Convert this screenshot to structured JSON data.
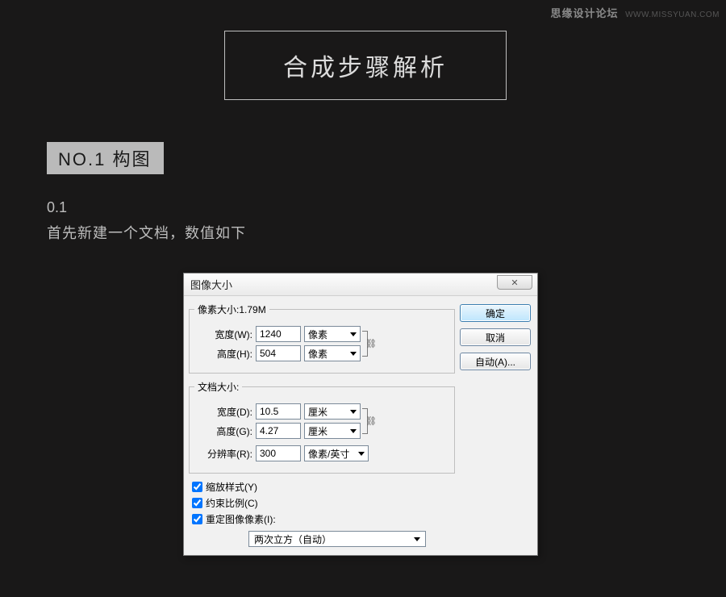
{
  "watermark": {
    "site": "思缘设计论坛",
    "url": "WWW.MISSYUAN.COM"
  },
  "heading": "合成步骤解析",
  "step": {
    "label": "NO.1 构图",
    "num": "0.1",
    "text": "首先新建一个文档，数值如下"
  },
  "dialog": {
    "title": "图像大小",
    "close_glyph": "✕",
    "pixel_group": {
      "legend": "像素大小:1.79M",
      "width_label": "宽度(W):",
      "width_value": "1240",
      "width_unit": "像素",
      "height_label": "高度(H):",
      "height_value": "504",
      "height_unit": "像素"
    },
    "doc_group": {
      "legend": "文档大小:",
      "width_label": "宽度(D):",
      "width_value": "10.5",
      "width_unit": "厘米",
      "height_label": "高度(G):",
      "height_value": "4.27",
      "height_unit": "厘米",
      "res_label": "分辨率(R):",
      "res_value": "300",
      "res_unit": "像素/英寸"
    },
    "checks": {
      "scale": "缩放样式(Y)",
      "constrain": "约束比例(C)",
      "resample": "重定图像像素(I):"
    },
    "method": "两次立方（自动）",
    "buttons": {
      "ok": "确定",
      "cancel": "取消",
      "auto": "自动(A)..."
    },
    "link_glyph": "⛓"
  }
}
